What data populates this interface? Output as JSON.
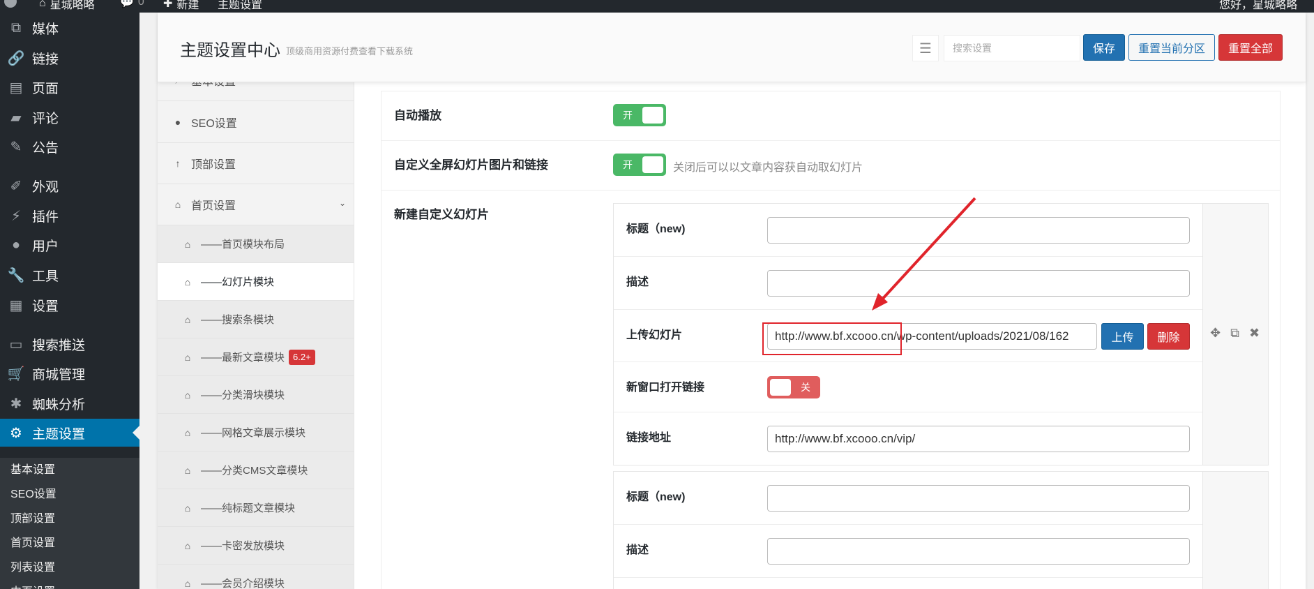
{
  "adminbar": {
    "site_name": "星城略略",
    "comments_count": "0",
    "new_label": "新建",
    "theme_settings_label": "主题设置",
    "greeting": "您好，星城略略"
  },
  "admin_menu": {
    "items": [
      {
        "label": "媒体",
        "icon": "media-icon"
      },
      {
        "label": "链接",
        "icon": "link-icon"
      },
      {
        "label": "页面",
        "icon": "page-icon"
      },
      {
        "label": "评论",
        "icon": "comment-icon"
      },
      {
        "label": "公告",
        "icon": "pin-icon"
      },
      {
        "label": "外观",
        "icon": "brush-icon"
      },
      {
        "label": "插件",
        "icon": "plugin-icon"
      },
      {
        "label": "用户",
        "icon": "user-icon"
      },
      {
        "label": "工具",
        "icon": "wrench-icon"
      },
      {
        "label": "设置",
        "icon": "settings-icon"
      },
      {
        "label": "搜索推送",
        "icon": "screen-icon"
      },
      {
        "label": "商城管理",
        "icon": "cart-icon"
      },
      {
        "label": "蜘蛛分析",
        "icon": "spider-icon"
      },
      {
        "label": "主题设置",
        "icon": "gear-icon"
      }
    ],
    "submenu": [
      "基本设置",
      "SEO设置",
      "顶部设置",
      "首页设置",
      "列表设置",
      "内页设置"
    ]
  },
  "header": {
    "title": "主题设置中心",
    "subtitle": "顶级商用资源付费查看下载系统",
    "search_placeholder": "搜索设置",
    "save_label": "保存",
    "reset_section_label": "重置当前分区",
    "reset_all_label": "重置全部"
  },
  "panel_nav": {
    "top_items": [
      {
        "label": "基本设置",
        "icon": "bolt-icon"
      },
      {
        "label": "SEO设置",
        "icon": "circle-icon"
      },
      {
        "label": "顶部设置",
        "icon": "arrow-up-icon"
      },
      {
        "label": "首页设置",
        "icon": "home-icon"
      }
    ],
    "sub_items": [
      {
        "label": "——首页模块布局",
        "badge": ""
      },
      {
        "label": "——幻灯片模块",
        "badge": ""
      },
      {
        "label": "——搜索条模块",
        "badge": ""
      },
      {
        "label": "——最新文章模块",
        "badge": "6.2+"
      },
      {
        "label": "——分类滑块模块",
        "badge": ""
      },
      {
        "label": "——网格文章展示模块",
        "badge": ""
      },
      {
        "label": "——分类CMS文章模块",
        "badge": ""
      },
      {
        "label": "——纯标题文章模块",
        "badge": ""
      },
      {
        "label": "——卡密发放模块",
        "badge": ""
      },
      {
        "label": "——会员介绍模块",
        "badge": ""
      }
    ]
  },
  "content": {
    "autoplay": {
      "label": "自动播放",
      "switch_text": "开",
      "state": "on"
    },
    "custom_fullscreen": {
      "label": "自定义全屏幻灯片图片和链接",
      "switch_text": "开",
      "state": "on",
      "help": "关闭后可以以文章内容获自动取幻灯片"
    },
    "new_slides_label": "新建自定义幻灯片",
    "slide1": {
      "title_label": "标题（new)",
      "title_value": "",
      "desc_label": "描述",
      "desc_value": "",
      "upload_label": "上传幻灯片",
      "upload_value": "http://www.bf.xcooo.cn/wp-content/uploads/2021/08/162",
      "upload_button": "上传",
      "delete_button": "删除",
      "newwin_label": "新窗口打开链接",
      "newwin_switch_text": "关",
      "newwin_state": "off",
      "link_label": "链接地址",
      "link_value": "http://www.bf.xcooo.cn/vip/"
    },
    "slide2": {
      "title_label": "标题（new)",
      "title_value": "",
      "desc_label": "描述",
      "desc_value": ""
    }
  },
  "colors": {
    "admin_dark": "#23282d",
    "admin_blue": "#0073aa",
    "switch_on": "#4ab866",
    "switch_off": "#e05d5d",
    "button_primary": "#2271b1",
    "button_danger": "#d63638",
    "annotation_red": "#e0242b"
  }
}
